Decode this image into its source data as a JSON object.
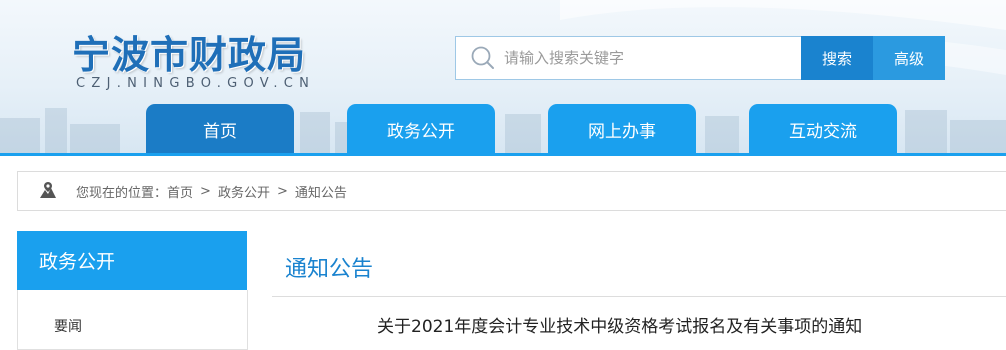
{
  "site": {
    "name": "宁波市财政局",
    "url": "CZJ.NINGBO.GOV.CN"
  },
  "search": {
    "placeholder": "请输入搜索关键字",
    "search_label": "搜索",
    "advanced_label": "高级"
  },
  "nav": {
    "items": [
      {
        "label": "首页",
        "active": true
      },
      {
        "label": "政务公开",
        "active": false
      },
      {
        "label": "网上办事",
        "active": false
      },
      {
        "label": "互动交流",
        "active": false
      }
    ]
  },
  "breadcrumb": {
    "prefix": "您现在的位置：",
    "items": [
      "首页",
      "政务公开",
      "通知公告"
    ],
    "separator": ">"
  },
  "sidebar": {
    "title": "政务公开",
    "items": [
      {
        "label": "要闻"
      }
    ]
  },
  "main": {
    "section_title": "通知公告",
    "article_title": "关于2021年度会计专业技术中级资格考试报名及有关事项的通知"
  },
  "colors": {
    "accent": "#1aa0ee",
    "accent_dark": "#1b7cc6",
    "button_search": "#1a83cf"
  }
}
